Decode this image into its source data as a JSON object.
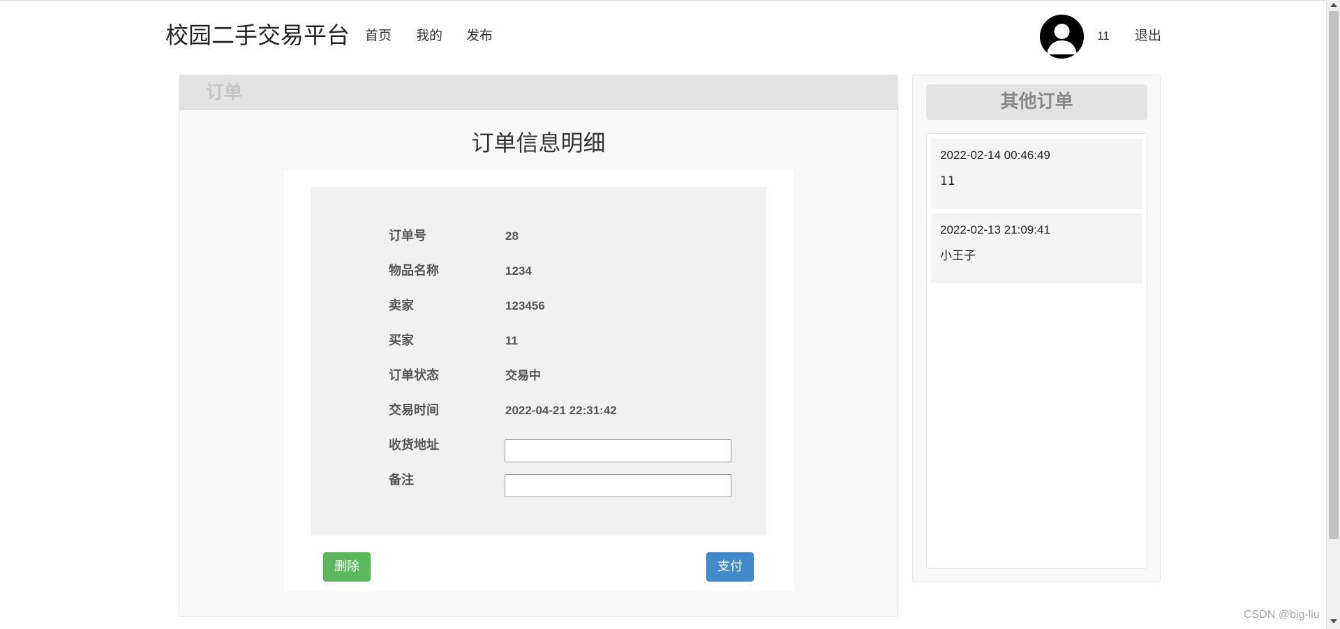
{
  "navbar": {
    "brand": "校园二手交易平台",
    "links": {
      "home": "首页",
      "mine": "我的",
      "publish": "发布"
    },
    "username": "11",
    "logout": "退出"
  },
  "main": {
    "panel_title": "订单",
    "heading": "订单信息明细",
    "fields": [
      {
        "label": "订单号",
        "value": "28"
      },
      {
        "label": "物品名称",
        "value": "1234"
      },
      {
        "label": "卖家",
        "value": "123456"
      },
      {
        "label": "买家",
        "value": "11"
      },
      {
        "label": "订单状态",
        "value": "交易中"
      },
      {
        "label": "交易时间",
        "value": "2022-04-21 22:31:42"
      }
    ],
    "address": {
      "label": "收货地址",
      "value": "",
      "placeholder": ""
    },
    "remark": {
      "label": "备注",
      "value": "",
      "placeholder": ""
    },
    "delete_button": "删除",
    "pay_button": "支付"
  },
  "side": {
    "title": "其他订单",
    "orders": [
      {
        "time": "2022-02-14 00:46:49",
        "user": "11"
      },
      {
        "time": "2022-02-13 21:09:41",
        "user": "小王子"
      }
    ]
  },
  "watermark": "CSDN @big-liu",
  "colors": {
    "delete_button": "#5cb85c",
    "pay_button": "#428bca",
    "panel_header": "#e3e3e3"
  },
  "icons": {
    "avatar": "user-avatar-icon"
  }
}
